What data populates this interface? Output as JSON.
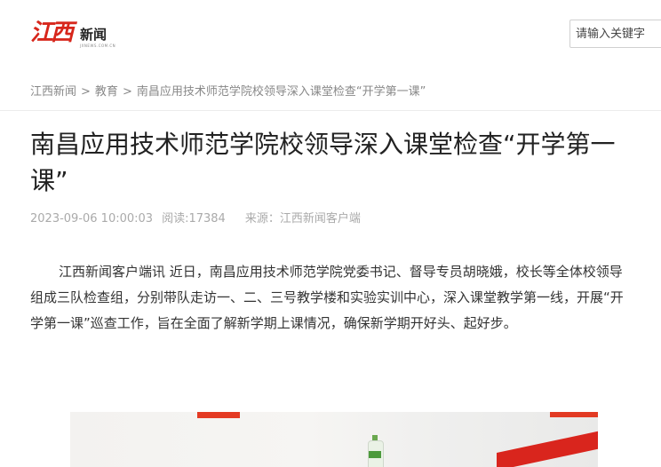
{
  "header": {
    "logo_text": "江西",
    "logo_news": "新闻",
    "logo_domain": "JXNEWS.COM.CN",
    "search_placeholder": "请输入关键字"
  },
  "breadcrumb": {
    "items": [
      "江西新闻",
      "教育",
      "南昌应用技术师范学院校领导深入课堂检查“开学第一课”"
    ],
    "separator": ">"
  },
  "article": {
    "title": "南昌应用技术师范学院校领导深入课堂检查“开学第一课”",
    "date": "2023-09-06 10:00:03",
    "reads": "阅读:17384",
    "source": "来源：江西新闻客户端",
    "paragraph": "江西新闻客户端讯 近日，南昌应用技术师范学院党委书记、督导专员胡晓娥，校长等全体校领导组成三队检查组，分别带队走访一、二、三号教学楼和实验实训中心，深入课堂教学第一线，开展“开学第一课”巡查工作，旨在全面了解新学期上课情况，确保新学期开好头、起好步。"
  },
  "colors": {
    "brand_red": "#d7261b",
    "meta_gray": "#aaaaaa",
    "breadcrumb_gray": "#888888"
  }
}
